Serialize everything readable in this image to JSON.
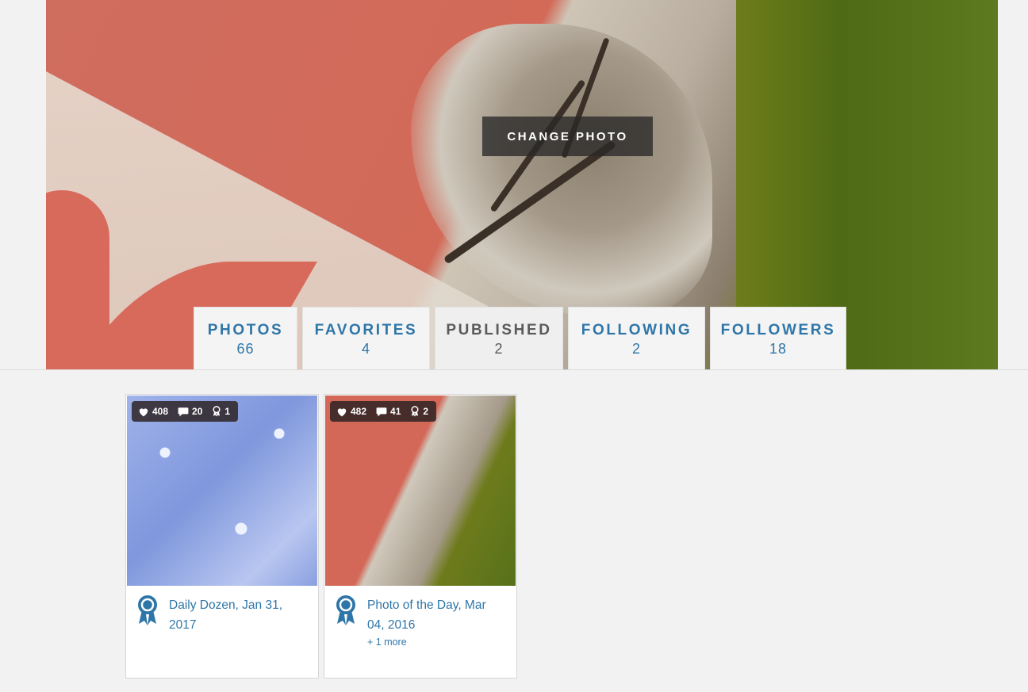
{
  "cover": {
    "change_photo_label": "CHANGE PHOTO"
  },
  "tabs": [
    {
      "label": "PHOTOS",
      "count": "66",
      "active": false
    },
    {
      "label": "FAVORITES",
      "count": "4",
      "active": false
    },
    {
      "label": "PUBLISHED",
      "count": "2",
      "active": true
    },
    {
      "label": "FOLLOWING",
      "count": "2",
      "active": false
    },
    {
      "label": "FOLLOWERS",
      "count": "18",
      "active": false
    }
  ],
  "photos": [
    {
      "likes": "408",
      "comments": "20",
      "awards": "1",
      "title": "Daily Dozen, Jan 31, 2017",
      "more": ""
    },
    {
      "likes": "482",
      "comments": "41",
      "awards": "2",
      "title": "Photo of the Day, Mar 04, 2016",
      "more": "+ 1 more"
    }
  ],
  "colors": {
    "accent": "#2f76a8",
    "active_tab_text": "#5a5a5a",
    "background": "#f2f2f2"
  },
  "icons": [
    "heart-icon",
    "comment-icon",
    "award-icon",
    "ribbon-award-icon"
  ]
}
